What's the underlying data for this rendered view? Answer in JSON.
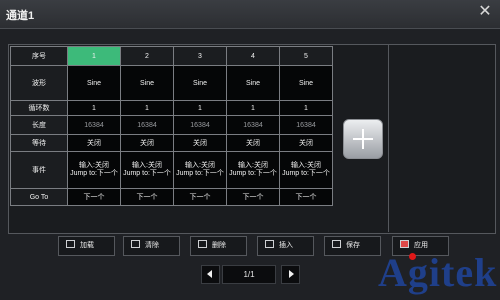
{
  "window": {
    "title": "通道1",
    "close_glyph": "✕"
  },
  "table": {
    "column_header_label": "序号",
    "columns": [
      "1",
      "2",
      "3",
      "4",
      "5"
    ],
    "rows": [
      {
        "label": "波形",
        "cells": [
          "Sine",
          "Sine",
          "Sine",
          "Sine",
          "Sine"
        ]
      },
      {
        "label": "循环数",
        "cells": [
          "1",
          "1",
          "1",
          "1",
          "1"
        ]
      },
      {
        "label": "长度",
        "cells": [
          "16384",
          "16384",
          "16384",
          "16384",
          "16384"
        ]
      },
      {
        "label": "等待",
        "cells": [
          "关闭",
          "关闭",
          "关闭",
          "关闭",
          "关闭"
        ]
      },
      {
        "label": "事件",
        "cells": [
          {
            "line1": "输入:关闭",
            "line2": "Jump to:下一个"
          },
          {
            "line1": "输入:关闭",
            "line2": "Jump to:下一个"
          },
          {
            "line1": "输入:关闭",
            "line2": "Jump to:下一个"
          },
          {
            "line1": "输入:关闭",
            "line2": "Jump to:下一个"
          },
          {
            "line1": "输入:关闭",
            "line2": "Jump to:下一个"
          }
        ]
      },
      {
        "label": "Go To",
        "cells": [
          "下一个",
          "下一个",
          "下一个",
          "下一个",
          "下一个"
        ]
      }
    ],
    "active_column": "1",
    "active_color": "#3dba7a"
  },
  "add_button": {
    "icon": "plus-icon"
  },
  "toolbar": {
    "buttons": [
      {
        "label": "加载",
        "icon": "load-icon"
      },
      {
        "label": "清除",
        "icon": "clear-icon"
      },
      {
        "label": "删除",
        "icon": "delete-icon"
      },
      {
        "label": "插入",
        "icon": "insert-icon"
      },
      {
        "label": "保存",
        "icon": "save-icon"
      },
      {
        "label": "应用",
        "icon": "apply-icon"
      }
    ]
  },
  "pager": {
    "current": "1/1"
  },
  "watermark": {
    "text": "Agitek",
    "color": "#1f3f8a",
    "dot_color": "#e01818"
  }
}
